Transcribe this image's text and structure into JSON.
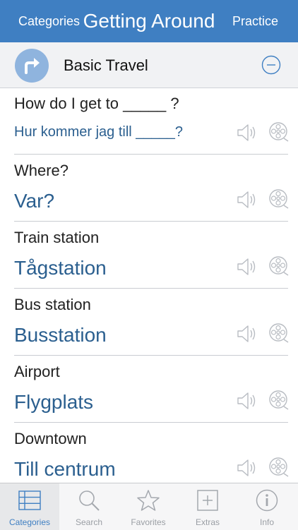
{
  "nav": {
    "left": "Categories",
    "title": "Getting Around",
    "right": "Practice"
  },
  "section": {
    "title": "Basic Travel"
  },
  "phrases": [
    {
      "en": "How do I get to _____ ?",
      "sv": "Hur kommer jag till _____?"
    },
    {
      "en": "Where?",
      "sv": "Var?"
    },
    {
      "en": "Train station",
      "sv": "Tågstation"
    },
    {
      "en": "Bus station",
      "sv": "Busstation"
    },
    {
      "en": "Airport",
      "sv": "Flygplats"
    },
    {
      "en": "Downtown",
      "sv": "Till centrum"
    }
  ],
  "tabs": [
    {
      "label": "Categories",
      "icon": "list-icon"
    },
    {
      "label": "Search",
      "icon": "search-icon"
    },
    {
      "label": "Favorites",
      "icon": "star-icon"
    },
    {
      "label": "Extras",
      "icon": "plus-box-icon"
    },
    {
      "label": "Info",
      "icon": "info-icon"
    }
  ],
  "colors": {
    "accent": "#3f7fc2",
    "phrase_text": "#2b5f8f",
    "badge": "#8fb4de"
  }
}
